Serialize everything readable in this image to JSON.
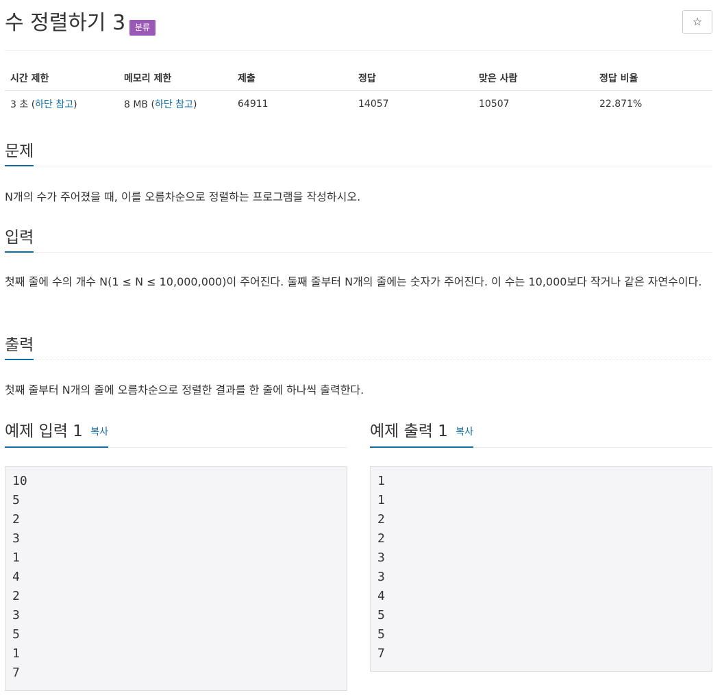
{
  "problem": {
    "title": "수 정렬하기 3",
    "tag": "분류",
    "star": "☆"
  },
  "info": {
    "headers": [
      "시간 제한",
      "메모리 제한",
      "제출",
      "정답",
      "맞은 사람",
      "정답 비율"
    ],
    "time_limit": "3 초",
    "memory_limit": "8 MB",
    "note_link": "하단 참고",
    "submissions": "64911",
    "accepted": "14057",
    "solvers": "10507",
    "ratio": "22.871%"
  },
  "sections": {
    "description_title": "문제",
    "description": "N개의 수가 주어졌을 때, 이를 오름차순으로 정렬하는 프로그램을 작성하시오.",
    "input_title": "입력",
    "input": "첫째 줄에 수의 개수 N(1 ≤ N ≤ 10,000,000)이 주어진다. 둘째 줄부터 N개의 줄에는 숫자가 주어진다. 이 수는 10,000보다 작거나 같은 자연수이다.",
    "output_title": "출력",
    "output": "첫째 줄부터 N개의 줄에 오름차순으로 정렬한 결과를 한 줄에 하나씩 출력한다."
  },
  "samples": {
    "input_title": "예제 입력 1",
    "output_title": "예제 출력 1",
    "copy_label": "복사",
    "input_text": "10\n5\n2\n3\n1\n4\n2\n3\n5\n1\n7",
    "output_text": "1\n1\n2\n2\n3\n3\n4\n5\n5\n7"
  },
  "colors": {
    "link": "#0e6ba8",
    "badge": "#9b59b6",
    "sample_bg": "#f5f5f7"
  }
}
